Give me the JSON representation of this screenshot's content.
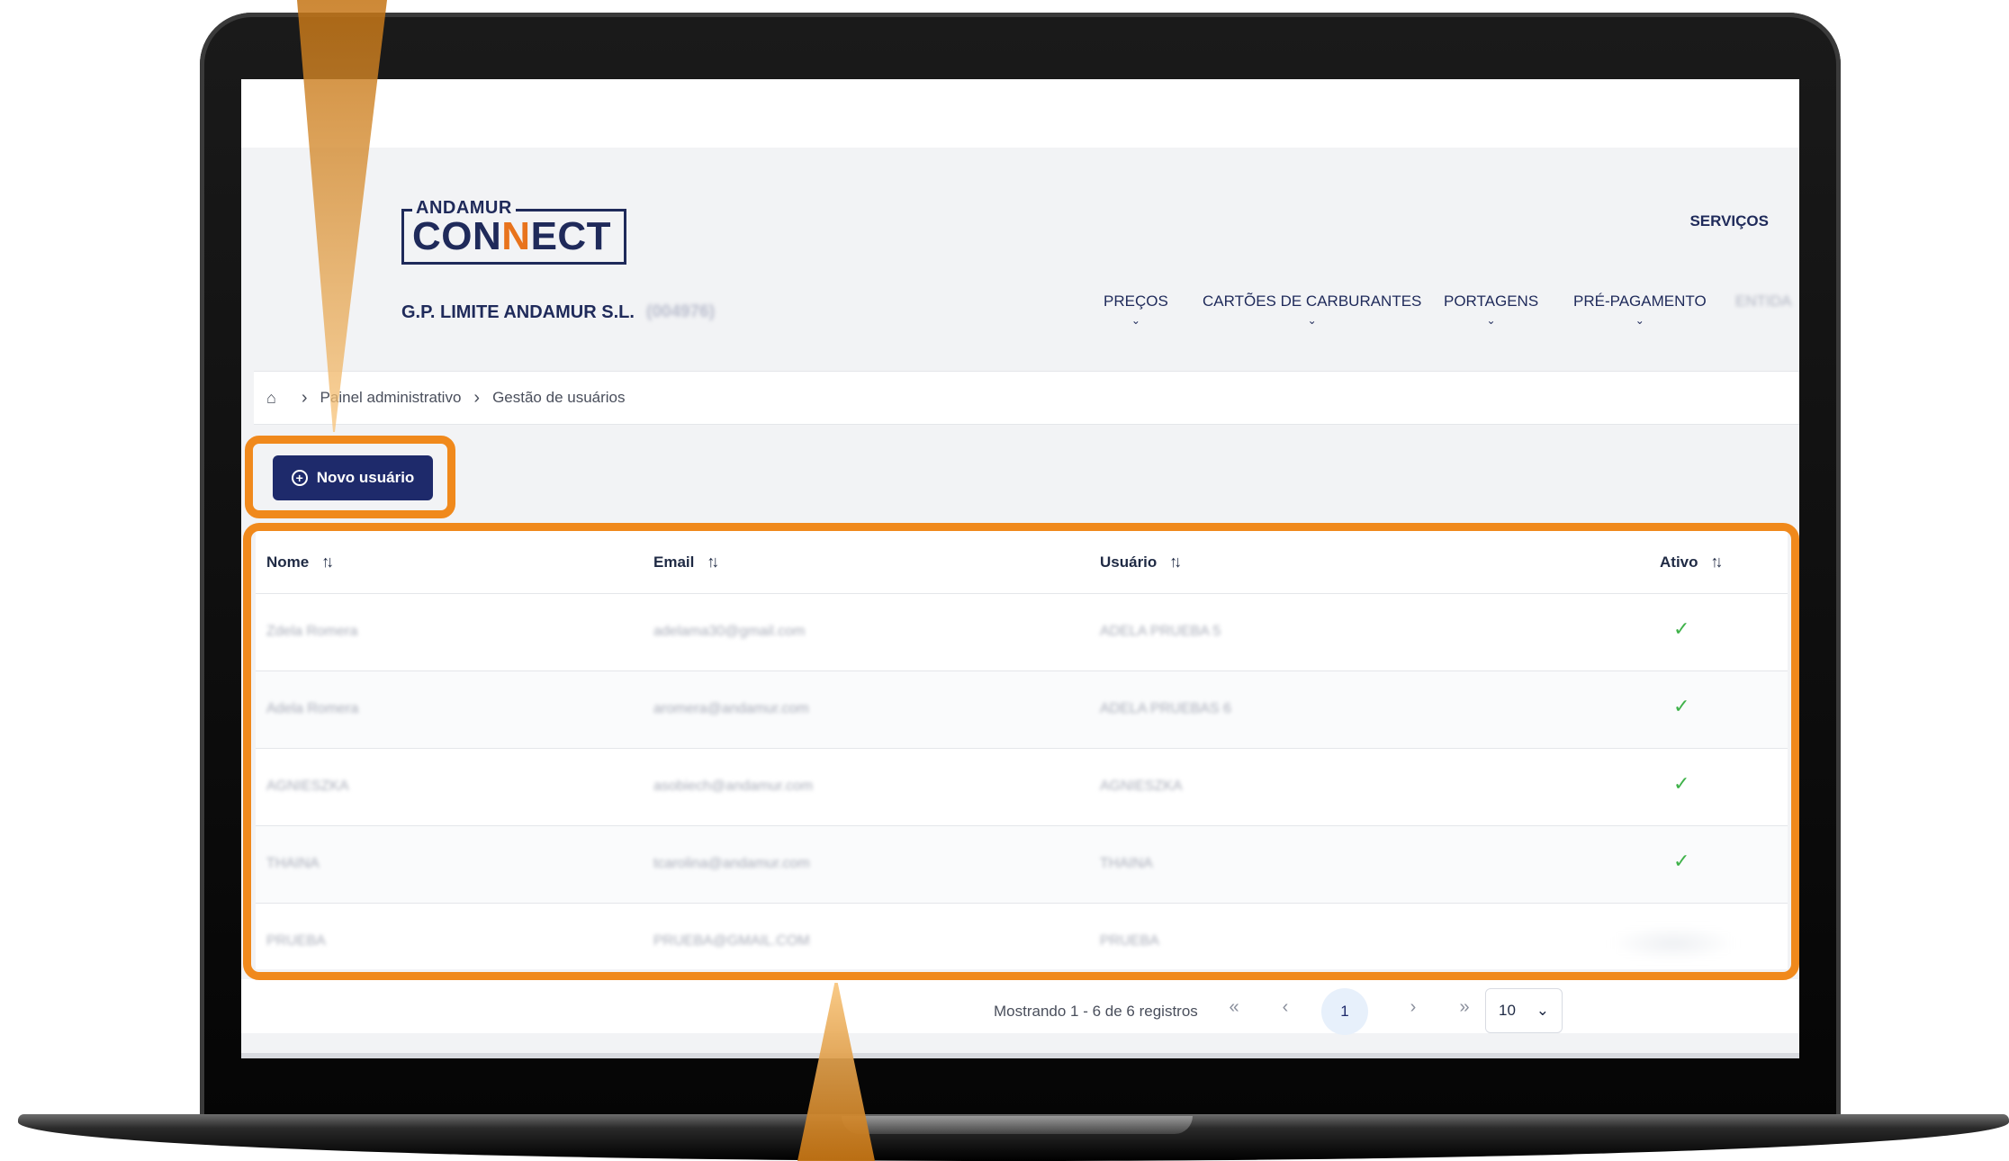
{
  "brand": {
    "logo_top": "ANDAMUR",
    "logo_main_1": "CON",
    "logo_main_accent": "N",
    "logo_main_2": "ECT",
    "company": "G.P. LIMITE ANDAMUR S.L.",
    "company_id": "(004976)",
    "accent_color": "#e8731c",
    "primary_color": "#1e2a6b"
  },
  "header": {
    "services": "SERVIÇOS",
    "nav": [
      {
        "label": "PREÇOS"
      },
      {
        "label": "CARTÕES DE CARBURANTES"
      },
      {
        "label": "PORTAGENS"
      },
      {
        "label": "PRÉ-PAGAMENTO"
      }
    ],
    "nav_blurred": "ENTIDA"
  },
  "breadcrumb": {
    "home_icon": "home-icon",
    "items": [
      "Painel administrativo",
      "Gestão de usuários"
    ]
  },
  "actions": {
    "new_user": "Novo usuário"
  },
  "table": {
    "columns": [
      "Nome",
      "Email",
      "Usuário",
      "Ativo"
    ],
    "rows": [
      {
        "nome": "Zdela Romera",
        "email": "adelama30@gmail.com",
        "usuario": "ADELA PRUEBA 5",
        "ativo": true
      },
      {
        "nome": "Adela Romera",
        "email": "aromera@andamur.com",
        "usuario": "ADELA PRUEBAS 6",
        "ativo": true
      },
      {
        "nome": "AGNIESZKA",
        "email": "asobiech@andamur.com",
        "usuario": "AGNIESZKA",
        "ativo": true
      },
      {
        "nome": "THAINA",
        "email": "tcarolina@andamur.com",
        "usuario": "THAINA",
        "ativo": true
      },
      {
        "nome": "PRUEBA",
        "email": "PRUEBA@GMAIL.COM",
        "usuario": "PRUEBA",
        "ativo": false
      }
    ],
    "active_color": "#3fb24a"
  },
  "pagination": {
    "summary": "Mostrando 1 - 6 de 6 registros",
    "first": "«",
    "prev": "‹",
    "current": "1",
    "next": "›",
    "last": "»",
    "page_size": "10"
  },
  "highlight_color": "#f0891c"
}
